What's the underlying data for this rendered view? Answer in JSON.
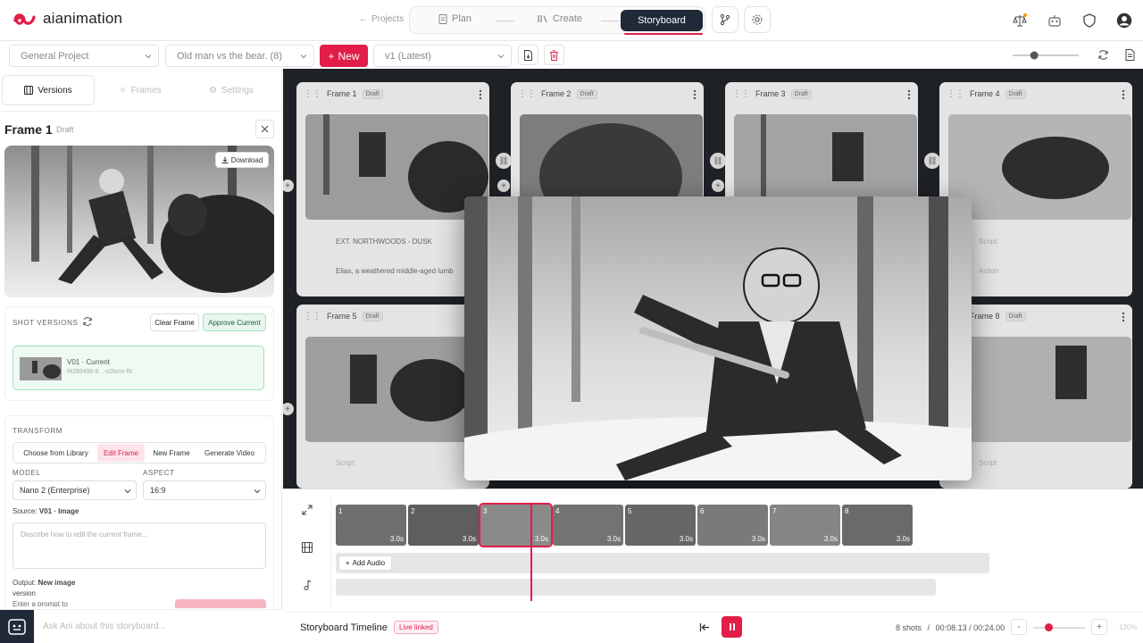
{
  "app": {
    "name": "aianimation",
    "accent": "#e11d48",
    "dark": "#1f2937"
  },
  "nav": {
    "projects_label": "Projects",
    "steps": [
      {
        "label": "Plan",
        "icon": "document-icon"
      },
      {
        "label": "Create",
        "icon": "library-icon"
      },
      {
        "label": "Storyboard",
        "active": true
      }
    ],
    "right_icons": [
      "scale-icon",
      "bot-icon",
      "shield-icon",
      "user-avatar-icon"
    ]
  },
  "toolbar": {
    "project_select": "General Project",
    "story_select": "Old man vs the bear. (8)",
    "new_label": "New",
    "version_select": "v1 (Latest)",
    "zoom_level": 0.3
  },
  "left_panel": {
    "tabs": [
      {
        "label": "Versions",
        "active": true
      },
      {
        "label": "Frames",
        "active": false
      },
      {
        "label": "Settings",
        "active": false
      }
    ],
    "frame_title": "Frame 1",
    "frame_status": "Draft",
    "download_label": "Download",
    "shot_versions": {
      "label": "SHOT VERSIONS",
      "clear_label": "Clear Frame",
      "approve_label": "Approve Current",
      "version": {
        "title": "V01 · Current",
        "id": "f4280498-8...-x2tsmr-f9"
      }
    },
    "transform": {
      "label": "TRANSFORM",
      "tabs": [
        "Choose from Library",
        "Edit Frame",
        "New Frame",
        "Generate Video"
      ],
      "active_tab": "Edit Frame",
      "model_label": "MODEL",
      "model_value": "Nano 2 (Enterprise)",
      "aspect_label": "ASPECT",
      "aspect_value": "16:9",
      "source_prefix": "Source:",
      "source_value": "V01 · Image",
      "prompt_placeholder": "Describe how to edit the current frame...",
      "output_prefix": "Output:",
      "output_value": "New image",
      "output_value2": "version",
      "cutoff_text": "Enter a prompt to"
    },
    "ask_placeholder": "Ask Ani about this storyboard..."
  },
  "frames": [
    {
      "name": "Frame 1",
      "status": "Draft",
      "scene": "EXT. NORTHWOODS - DUSK",
      "action": "Elias, a weathered middle-aged lumb"
    },
    {
      "name": "Frame 2",
      "status": "Draft"
    },
    {
      "name": "Frame 3",
      "status": "Draft"
    },
    {
      "name": "Frame 4",
      "status": "Draft",
      "scene": "Script",
      "action": "Action"
    },
    {
      "name": "Frame 5",
      "status": "Draft",
      "scene": "Script"
    },
    {
      "name": "Frame 8",
      "status": "Draft",
      "scene": "Script"
    }
  ],
  "timeline": {
    "title": "Storyboard Timeline",
    "live_label": "Live linked",
    "shots": [
      {
        "num": "1",
        "dur": "3.0s"
      },
      {
        "num": "2",
        "dur": "3.0s"
      },
      {
        "num": "3",
        "dur": "3.0s",
        "selected": true
      },
      {
        "num": "4",
        "dur": "3.0s"
      },
      {
        "num": "5",
        "dur": "3.0s"
      },
      {
        "num": "6",
        "dur": "3.0s"
      },
      {
        "num": "7",
        "dur": "3.0s"
      },
      {
        "num": "8",
        "dur": "3.0s"
      }
    ],
    "add_audio_label": "Add Audio",
    "shots_count": "8 shots",
    "separator": "/",
    "time": "00:08.13 / 00:24.00",
    "zoom_minus": "-",
    "zoom_plus": "+",
    "zoom_pct": "120%"
  }
}
